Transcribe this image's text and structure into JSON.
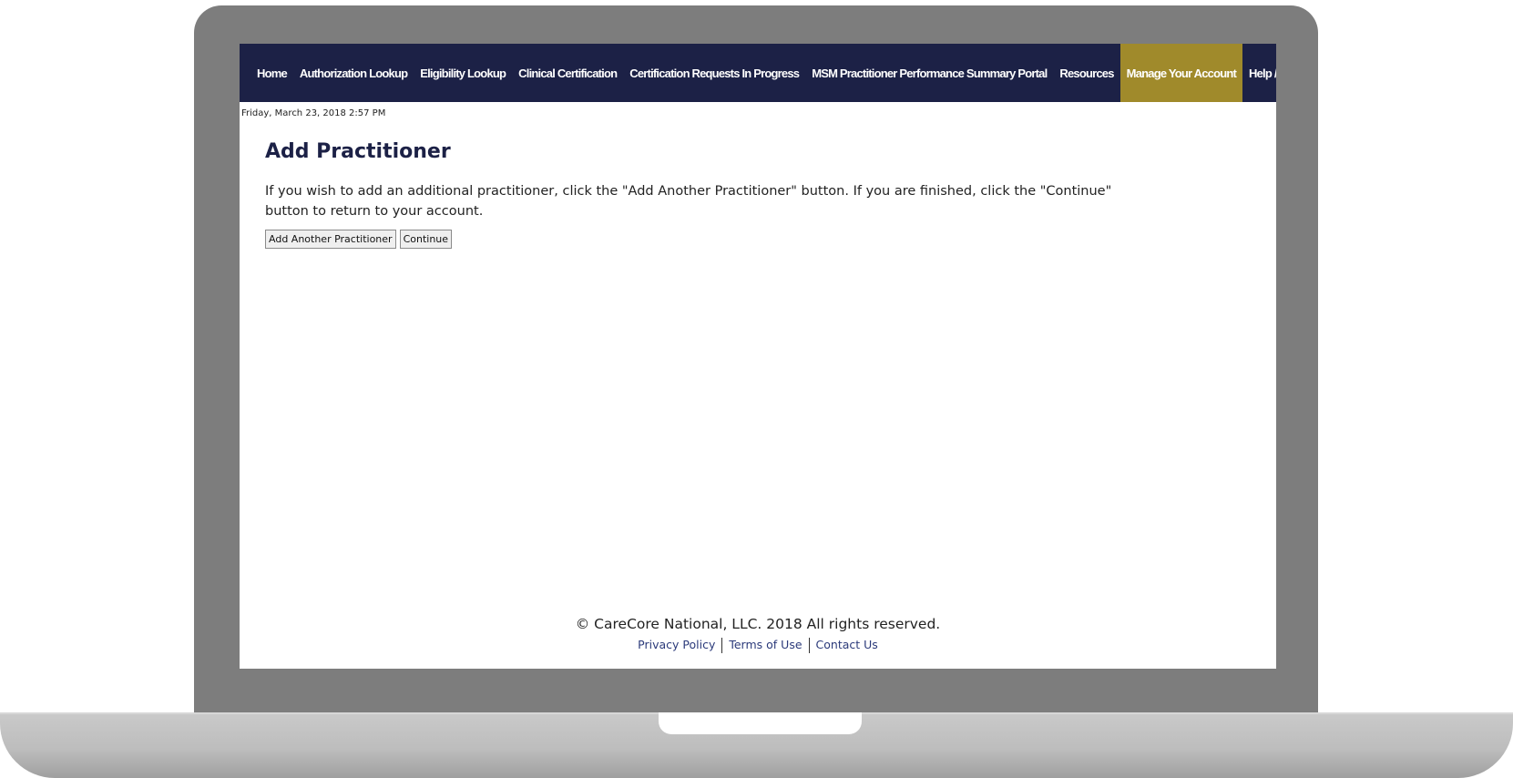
{
  "nav": {
    "items": [
      {
        "label": "Home"
      },
      {
        "label": "Authorization Lookup"
      },
      {
        "label": "Eligibility Lookup"
      },
      {
        "label": "Clinical Certification"
      },
      {
        "label": "Certification Requests In Progress"
      },
      {
        "label": "MSM Practitioner Performance Summary Portal"
      },
      {
        "label": "Resources"
      },
      {
        "label": "Manage Your Account"
      },
      {
        "label": "Help / Contact Us"
      }
    ],
    "active_index": 7,
    "active_color": "#a08a2b",
    "bar_color": "#1c2146"
  },
  "date_line": "Friday, March 23, 2018 2:57 PM",
  "page": {
    "title": "Add Practitioner",
    "instructions": "If you wish to add an additional practitioner, click the \"Add Another Practitioner\" button. If you are finished, click the \"Continue\" button to return to your account.",
    "buttons": {
      "add_another": "Add Another Practitioner",
      "continue": "Continue"
    }
  },
  "footer": {
    "copyright": "© CareCore National, LLC. 2018 All rights reserved.",
    "links": {
      "privacy": "Privacy Policy",
      "terms": "Terms of Use",
      "contact": "Contact Us"
    }
  }
}
